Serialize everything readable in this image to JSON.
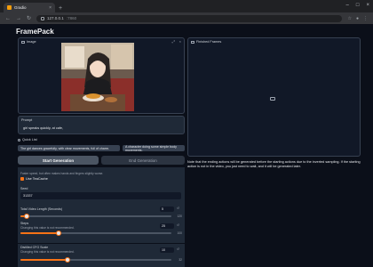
{
  "browser": {
    "tab_title": "Gradio",
    "address": "127.0.0.1",
    "address_port": ":7860"
  },
  "app": {
    "title": "FramePack"
  },
  "image_panel": {
    "label": "Image"
  },
  "prompt": {
    "label": "Prompt",
    "value": "girl speaks quickly, at cafe,"
  },
  "quick_list": {
    "label": "Quick List",
    "items": [
      "The girl dances gracefully, with clear movements, full of charm.",
      "A character doing some simple body movements."
    ]
  },
  "buttons": {
    "start": "Start Generation",
    "end": "End Generation"
  },
  "settings": {
    "speed_note": "Faster speed, but often makes hands and fingers slightly worse.",
    "teacache_label": "Use TeaCache",
    "teacache_checked": true,
    "seed_label": "Seed",
    "seed_value": "31337",
    "length_label": "Total Video Length (Seconds)",
    "length_value": "5",
    "length_max": "120",
    "length_fraction": 0.04,
    "steps_label": "Steps",
    "steps_note": "Changing this value is not recommended.",
    "steps_value": "25",
    "steps_max": "100",
    "steps_fraction": 0.25,
    "cfg_label": "Distilled CFG Scale",
    "cfg_note": "Changing this value is not recommended.",
    "cfg_value": "10",
    "cfg_max": "32",
    "cfg_fraction": 0.31
  },
  "output": {
    "label": "Finished Frames",
    "note": "Note that the ending actions will be generated before the starting actions due to the inverted sampling. If the starting action is not in the video, you just need to wait, and it will be generated later."
  }
}
